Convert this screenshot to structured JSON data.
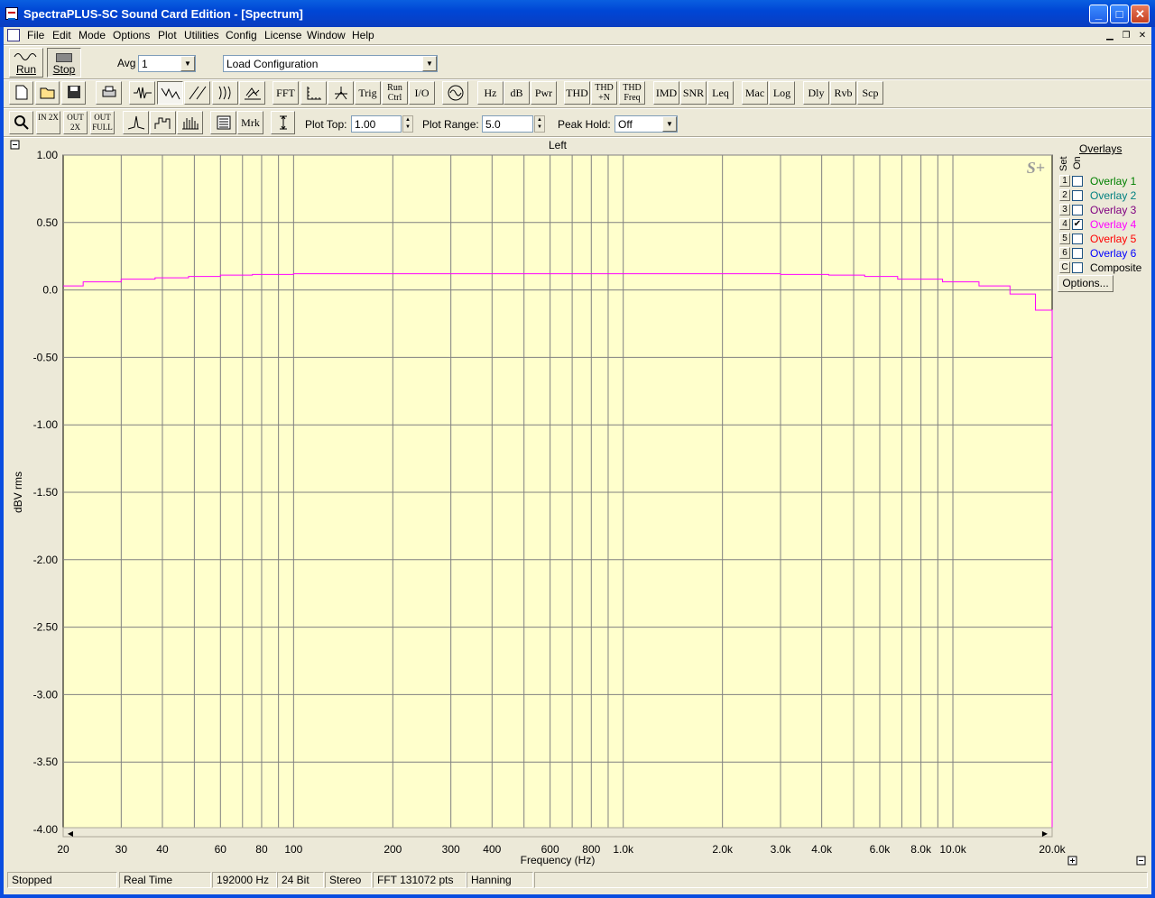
{
  "window": {
    "title": "SpectraPLUS-SC Sound Card Edition - [Spectrum]",
    "min": "_",
    "max": "□",
    "close": "✕"
  },
  "menu": [
    "File",
    "Edit",
    "Mode",
    "Options",
    "Plot",
    "Utilities",
    "Config",
    "License",
    "Window",
    "Help"
  ],
  "toolbar1": {
    "run_label": "Run",
    "stop_label": "Stop",
    "avg_label": "Avg",
    "avg_value": "1",
    "config_value": "Load Configuration"
  },
  "toolbar2": {
    "fft": "FFT",
    "trig": "Trig",
    "run_ctrl": "Run Ctrl",
    "io": "I/O",
    "hz": "Hz",
    "db": "dB",
    "pwr": "Pwr",
    "thd": "THD",
    "thd_n": "THD +N",
    "thd_freq": "THD Freq",
    "imd": "IMD",
    "snr": "SNR",
    "leq": "Leq",
    "mac": "Mac",
    "log": "Log",
    "dly": "Dly",
    "rvb": "Rvb",
    "scp": "Scp"
  },
  "toolbar3": {
    "zoom_in": "IN 2X",
    "zoom_out": "OUT 2X",
    "zoom_full": "OUT FULL",
    "mrk": "Mrk",
    "plot_top_label": "Plot Top:",
    "plot_top_value": "1.00",
    "plot_range_label": "Plot Range:",
    "plot_range_value": "5.0",
    "peak_hold_label": "Peak Hold:",
    "peak_hold_value": "Off"
  },
  "overlays": {
    "title": "Overlays",
    "set_header": "Set",
    "on_header": "On",
    "items": [
      {
        "num": "1",
        "name": "Overlay 1",
        "checked": false,
        "color": "#008000"
      },
      {
        "num": "2",
        "name": "Overlay 2",
        "checked": false,
        "color": "#008080"
      },
      {
        "num": "3",
        "name": "Overlay 3",
        "checked": false,
        "color": "#800080"
      },
      {
        "num": "4",
        "name": "Overlay 4",
        "checked": true,
        "color": "#ff00ff"
      },
      {
        "num": "5",
        "name": "Overlay 5",
        "checked": false,
        "color": "#ff0000"
      },
      {
        "num": "6",
        "name": "Overlay 6",
        "checked": false,
        "color": "#0000ff"
      },
      {
        "num": "C",
        "name": "Composite",
        "checked": false,
        "color": "#000000"
      }
    ],
    "options_label": "Options..."
  },
  "chart_data": {
    "type": "line",
    "title": "Left",
    "xlabel": "Frequency (Hz)",
    "ylabel": "dBV rms",
    "xscale": "log",
    "xlim": [
      20,
      20000
    ],
    "ylim": [
      -4.0,
      1.0
    ],
    "yticks": [
      "1.00",
      "0.50",
      "0.0",
      "-0.50",
      "-1.00",
      "-1.50",
      "-2.00",
      "-2.50",
      "-3.00",
      "-3.50",
      "-4.00"
    ],
    "ytick_values": [
      1.0,
      0.5,
      0.0,
      -0.5,
      -1.0,
      -1.5,
      -2.0,
      -2.5,
      -3.0,
      -3.5,
      -4.0
    ],
    "xticks": [
      "20",
      "30",
      "40",
      "60",
      "80",
      "100",
      "200",
      "300",
      "400",
      "600",
      "800",
      "1.0k",
      "2.0k",
      "3.0k",
      "4.0k",
      "6.0k",
      "8.0k",
      "10.0k",
      "20.0k"
    ],
    "xtick_values": [
      20,
      30,
      40,
      60,
      80,
      100,
      200,
      300,
      400,
      600,
      800,
      1000,
      2000,
      3000,
      4000,
      6000,
      8000,
      10000,
      20000
    ],
    "grid": true,
    "watermark": "S+",
    "background": "#ffffcc",
    "series": [
      {
        "color": "#ff00ff",
        "x": [
          20,
          23,
          30,
          38,
          48,
          60,
          75,
          100,
          200,
          400,
          1000,
          2000,
          3000,
          4200,
          5400,
          6800,
          9300,
          12000,
          14900,
          17800,
          20000
        ],
        "y": [
          0.03,
          0.06,
          0.08,
          0.09,
          0.1,
          0.11,
          0.115,
          0.12,
          0.12,
          0.12,
          0.12,
          0.12,
          0.115,
          0.11,
          0.1,
          0.08,
          0.06,
          0.03,
          -0.03,
          -0.15,
          -4.0
        ]
      }
    ]
  },
  "status": [
    "Stopped",
    "Real Time",
    "192000 Hz",
    "24 Bit",
    "Stereo",
    "FFT 131072 pts",
    "Hanning"
  ]
}
